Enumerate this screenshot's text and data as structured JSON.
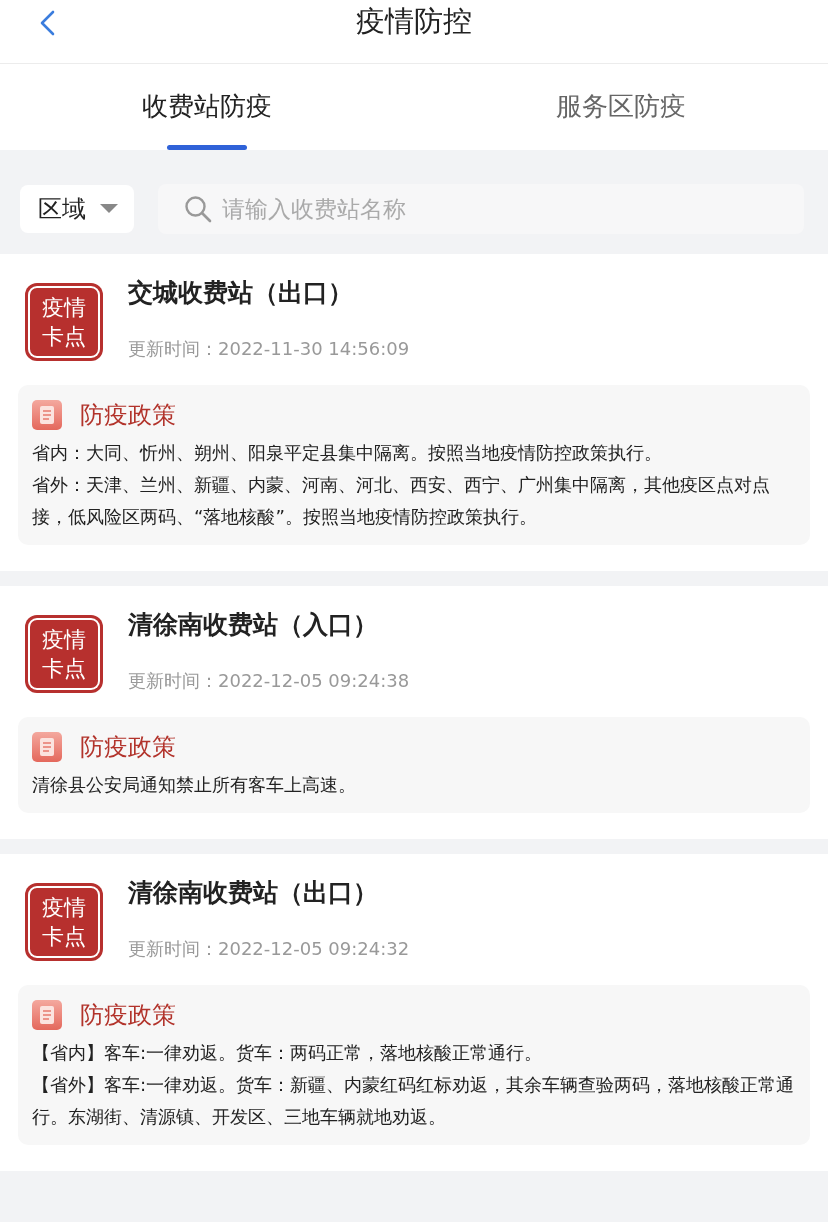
{
  "header": {
    "title": "疫情防控"
  },
  "tabs": [
    {
      "label": "收费站防疫",
      "selected": true
    },
    {
      "label": "服务区防疫",
      "selected": false
    }
  ],
  "filter": {
    "region": "区域",
    "placeholder": "请输入收费站名称"
  },
  "stations": [
    {
      "badge": [
        "疫情",
        "卡点"
      ],
      "name": "交城收费站（出口）",
      "updated": "更新时间：2022-11-30 14:56:09",
      "policy_title": "防疫政策",
      "policy_lines": [
        "省内：大同、忻州、朔州、阳泉平定县集中隔离。按照当地疫情防控政策执行。",
        "省外：天津、兰州、新疆、内蒙、河南、河北、西安、西宁、广州集中隔离，其他疫区点对点接，低风险区两码、“落地核酸”。按照当地疫情防控政策执行。"
      ]
    },
    {
      "badge": [
        "疫情",
        "卡点"
      ],
      "name": "清徐南收费站（入口）",
      "updated": "更新时间：2022-12-05 09:24:38",
      "policy_title": "防疫政策",
      "policy_lines": [
        "清徐县公安局通知禁止所有客车上高速。"
      ]
    },
    {
      "badge": [
        "疫情",
        "卡点"
      ],
      "name": "清徐南收费站（出口）",
      "updated": "更新时间：2022-12-05 09:24:32",
      "policy_title": "防疫政策",
      "policy_lines": [
        "【省内】客车:一律劝返。货车：两码正常，落地核酸正常通行。",
        "【省外】客车:一律劝返。货车：新疆、内蒙红码红标劝返，其余车辆查验两码，落地核酸正常通行。东湖街、清源镇、开发区、三地车辆就地劝返。"
      ]
    }
  ]
}
